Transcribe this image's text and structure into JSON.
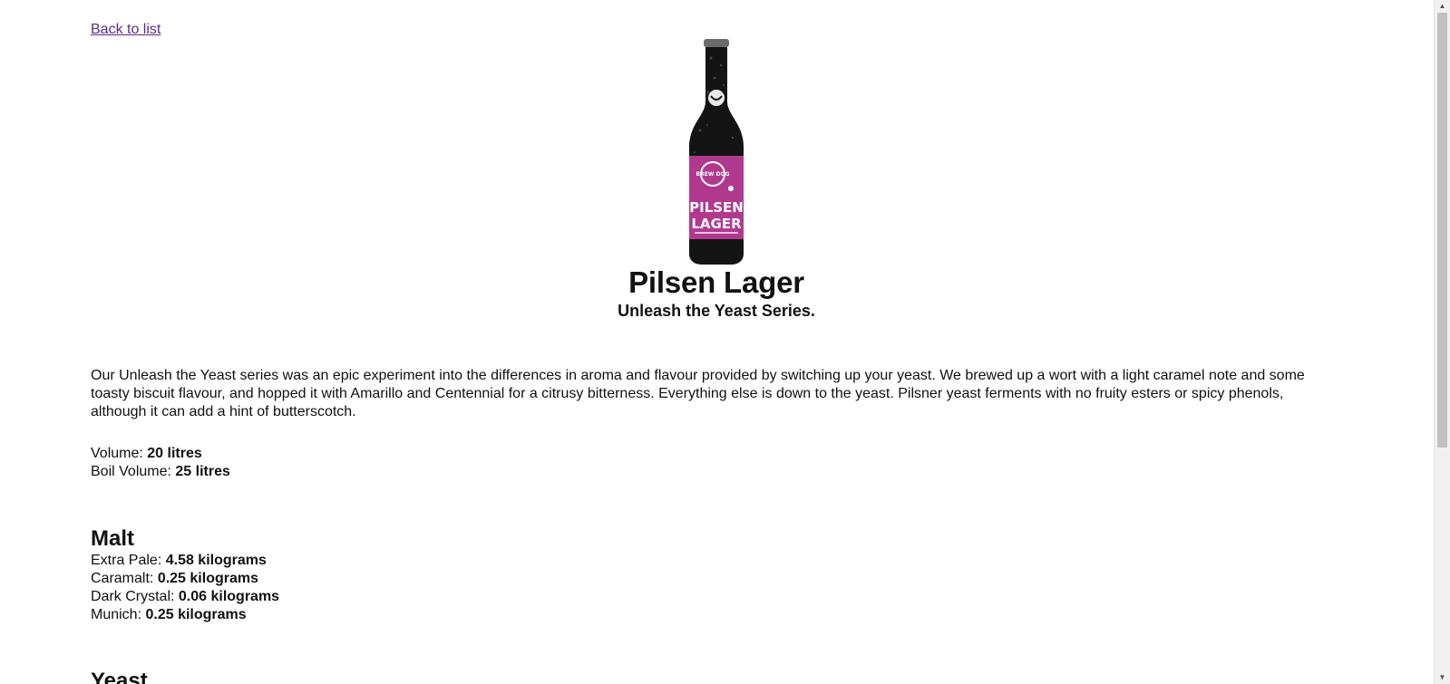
{
  "nav": {
    "back_label": "Back to list"
  },
  "beer": {
    "name": "Pilsen Lager",
    "tagline": "Unleash the Yeast Series.",
    "image": {
      "alt": "Pilsen Lager bottle",
      "label_top": "BREW DOG",
      "label_line1": "PILSEN",
      "label_line2": "LAGER",
      "label_color": "#b0398f"
    },
    "description": "Our Unleash the Yeast series was an epic experiment into the differences in aroma and flavour provided by switching up your yeast. We brewed up a wort with a light caramel note and some toasty biscuit flavour, and hopped it with Amarillo and Centennial for a citrusy bitterness. Everything else is down to the yeast. Pilsner yeast ferments with no fruity esters or spicy phenols, although it can add a hint of butterscotch.",
    "volume": {
      "label": "Volume:",
      "value": "20 litres"
    },
    "boil_volume": {
      "label": "Boil Volume:",
      "value": "25 litres"
    }
  },
  "malt": {
    "title": "Malt",
    "items": [
      {
        "name": "Extra Pale:",
        "amount": "4.58 kilograms"
      },
      {
        "name": "Caramalt:",
        "amount": "0.25 kilograms"
      },
      {
        "name": "Dark Crystal:",
        "amount": "0.06 kilograms"
      },
      {
        "name": "Munich:",
        "amount": "0.25 kilograms"
      }
    ]
  },
  "yeast": {
    "title": "Yeast"
  },
  "scrollbar": {
    "up_icon": "triangle-up",
    "down_icon": "triangle-down"
  }
}
